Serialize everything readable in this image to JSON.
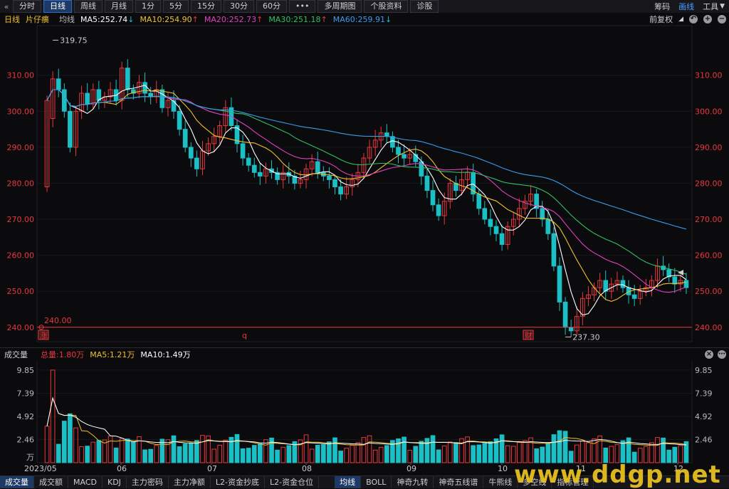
{
  "toolbar": {
    "back_icon": "back-arrow-icon",
    "periods": [
      "分时",
      "日线",
      "周线",
      "月线",
      "1分",
      "5分",
      "15分",
      "30分",
      "60分",
      "•••",
      "多周期图",
      "个股资料",
      "诊股"
    ],
    "active_period": "日线",
    "right": {
      "chip": "筹码",
      "draw": "画线",
      "tools": "工具"
    }
  },
  "legend": {
    "period": "日线",
    "name": "片仔癀",
    "ma_label": "均线",
    "ma": [
      {
        "text": "MA5:252.74",
        "arrow": "↓",
        "color": "#ffffff"
      },
      {
        "text": "MA10:254.90",
        "arrow": "↑",
        "color": "#f0c030"
      },
      {
        "text": "MA20:252.73",
        "arrow": "↑",
        "color": "#e040c0"
      },
      {
        "text": "MA30:251.18",
        "arrow": "↑",
        "color": "#30c060"
      },
      {
        "text": "MA60:259.91",
        "arrow": "↓",
        "color": "#3a9cf0"
      }
    ],
    "adjust": "前复权",
    "adjust_icon": "dropdown-triangle-icon"
  },
  "vol_header": {
    "title": "成交量",
    "total": "总量:1.80万",
    "ma5": "MA5:1.21万",
    "ma10": "MA10:1.49万"
  },
  "bottom_tabs": [
    "成交量",
    "成交额",
    "MACD",
    "KDJ",
    "主力密码",
    "主力净额",
    "L2-资金抄底",
    "L2-资金仓位"
  ],
  "bottom_tabs_right": [
    "均线",
    "BOLL",
    "神奇九转",
    "神奇五线谱",
    "牛熊线",
    "多空线",
    "指标管理"
  ],
  "watermark": "www.ddgp.net",
  "colors": {
    "up": "#e8383d",
    "down": "#1ac0c6",
    "bg": "#0b0b0e",
    "grid": "#1e1e24"
  },
  "chart_data": {
    "type": "candlestick",
    "price_axis": {
      "ticks": [
        "310.00",
        "300.00",
        "290.00",
        "280.00",
        "270.00",
        "260.00",
        "250.00",
        "240.00"
      ],
      "ylim": [
        236,
        323
      ]
    },
    "annotations": {
      "high": "319.75",
      "low": "237.30",
      "line": "240.00",
      "markers": [
        "涨",
        "q",
        "财"
      ]
    },
    "x_ticks": [
      "2023/05",
      "06",
      "07",
      "08",
      "09",
      "10",
      "11",
      "12"
    ],
    "volume_axis": {
      "ticks": [
        "9.85",
        "7.39",
        "4.92",
        "2.46",
        "万"
      ],
      "ylim": [
        0,
        10.6
      ]
    },
    "candles": [
      [
        279,
        303
      ],
      [
        298,
        309
      ],
      [
        309,
        306
      ],
      [
        306,
        300
      ],
      [
        300,
        290
      ],
      [
        290,
        300
      ],
      [
        300,
        305
      ],
      [
        305,
        302
      ],
      [
        302,
        306
      ],
      [
        306,
        303
      ],
      [
        303,
        304
      ],
      [
        304,
        306
      ],
      [
        306,
        303
      ],
      [
        303,
        312
      ],
      [
        312,
        306
      ],
      [
        306,
        305
      ],
      [
        305,
        308
      ],
      [
        308,
        305
      ],
      [
        305,
        304
      ],
      [
        304,
        306
      ],
      [
        306,
        301
      ],
      [
        301,
        303
      ],
      [
        303,
        300
      ],
      [
        300,
        295
      ],
      [
        295,
        290
      ],
      [
        290,
        287
      ],
      [
        287,
        284
      ],
      [
        284,
        289
      ],
      [
        289,
        291
      ],
      [
        291,
        293
      ],
      [
        293,
        296
      ],
      [
        296,
        301
      ],
      [
        301,
        296
      ],
      [
        296,
        291
      ],
      [
        291,
        287
      ],
      [
        287,
        285
      ],
      [
        285,
        283
      ],
      [
        283,
        282
      ],
      [
        282,
        284
      ],
      [
        284,
        283
      ],
      [
        283,
        281
      ],
      [
        281,
        283
      ],
      [
        283,
        282
      ],
      [
        282,
        280
      ],
      [
        280,
        281
      ],
      [
        281,
        284
      ],
      [
        284,
        286
      ],
      [
        286,
        283
      ],
      [
        283,
        282
      ],
      [
        282,
        281
      ],
      [
        281,
        279
      ],
      [
        279,
        277
      ],
      [
        277,
        279
      ],
      [
        279,
        281
      ],
      [
        281,
        283
      ],
      [
        283,
        287
      ],
      [
        287,
        290
      ],
      [
        290,
        292
      ],
      [
        292,
        294
      ],
      [
        294,
        293
      ],
      [
        293,
        290
      ],
      [
        290,
        288
      ],
      [
        288,
        287
      ],
      [
        287,
        288
      ],
      [
        288,
        286
      ],
      [
        286,
        282
      ],
      [
        282,
        278
      ],
      [
        278,
        274
      ],
      [
        274,
        271
      ],
      [
        271,
        275
      ],
      [
        275,
        280
      ],
      [
        280,
        278
      ],
      [
        278,
        281
      ],
      [
        281,
        283
      ],
      [
        283,
        277
      ],
      [
        277,
        273
      ],
      [
        273,
        270
      ],
      [
        270,
        268
      ],
      [
        268,
        266
      ],
      [
        266,
        263
      ],
      [
        263,
        268
      ],
      [
        268,
        270
      ],
      [
        270,
        273
      ],
      [
        273,
        275
      ],
      [
        275,
        277
      ],
      [
        277,
        273
      ],
      [
        273,
        270
      ],
      [
        270,
        266
      ],
      [
        266,
        257
      ],
      [
        257,
        247
      ],
      [
        247,
        240
      ],
      [
        240,
        239
      ],
      [
        239,
        243
      ],
      [
        243,
        248
      ],
      [
        248,
        249
      ],
      [
        249,
        251
      ],
      [
        251,
        253
      ],
      [
        253,
        250
      ],
      [
        250,
        252
      ],
      [
        252,
        253
      ],
      [
        253,
        251
      ],
      [
        251,
        249
      ],
      [
        249,
        248
      ],
      [
        248,
        250
      ],
      [
        250,
        251
      ],
      [
        251,
        253
      ],
      [
        253,
        257
      ],
      [
        257,
        256
      ],
      [
        256,
        254
      ],
      [
        254,
        252
      ],
      [
        252,
        253
      ],
      [
        253,
        251
      ]
    ],
    "ma_lines": [
      "MA5",
      "MA10",
      "MA20",
      "MA30",
      "MA60"
    ]
  }
}
